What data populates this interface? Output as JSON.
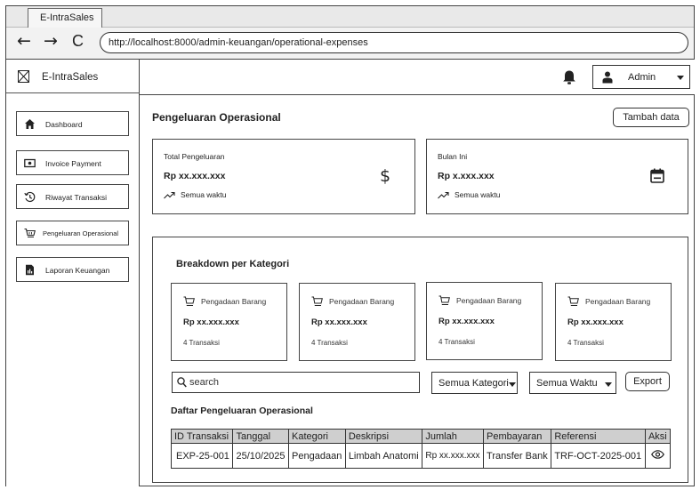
{
  "browser": {
    "tab_title": "E-IntraSales",
    "url": "http://localhost:8000/admin-keuangan/operational-expenses",
    "nav": {
      "back": "←",
      "forward": "→",
      "reload": "C"
    }
  },
  "sidebar": {
    "brand": "E-IntraSales",
    "items": [
      {
        "label": "Dashboard",
        "icon": "home-icon"
      },
      {
        "label": "Invoice Payment",
        "icon": "money-icon"
      },
      {
        "label": "Riwayat Transaksi",
        "icon": "history-icon"
      },
      {
        "label": "Pengeluaran Operasional",
        "icon": "cart-icon"
      },
      {
        "label": "Laporan Keuangan",
        "icon": "report-icon"
      }
    ]
  },
  "topbar": {
    "user": "Admin"
  },
  "page": {
    "title": "Pengeluaran Operasional",
    "add_button": "Tambah data"
  },
  "summary": [
    {
      "title": "Total Pengeluaran",
      "value": "Rp xx.xxx.xxx",
      "sub": "Semua waktu",
      "symbol": "$"
    },
    {
      "title": "Bulan Ini",
      "value": "Rp x.xxx.xxx",
      "sub": "Semua waktu",
      "icon": "calendar-icon"
    }
  ],
  "breakdown": {
    "title": "Breakdown per Kategori",
    "cards": [
      {
        "name": "Pengadaan Barang",
        "value": "Rp xx.xxx.xxx",
        "count": "4 Transaksi"
      },
      {
        "name": "Pengadaan Barang",
        "value": "Rp xx.xxx.xxx",
        "count": "4 Transaksi"
      },
      {
        "name": "Pengadaan Barang",
        "value": "Rp xx.xxx.xxx",
        "count": "4 Transaksi"
      },
      {
        "name": "Pengadaan Barang",
        "value": "Rp xx.xxx.xxx",
        "count": "4 Transaksi"
      }
    ]
  },
  "filters": {
    "search_placeholder": "search",
    "category": "Semua Kategori",
    "period": "Semua Waktu",
    "export": "Export"
  },
  "table": {
    "title": "Daftar Pengeluaran Operasional",
    "columns": [
      "ID Transaksi",
      "Tanggal",
      "Kategori",
      "Deskripsi",
      "Jumlah",
      "Pembayaran",
      "Referensi",
      "Aksi"
    ],
    "rows": [
      [
        "EXP-25-001",
        "25/10/2025",
        "Pengadaan",
        "Limbah Anatomi",
        "Rp xx.xxx.xxx",
        "Transfer Bank",
        "TRF-OCT-2025-001"
      ]
    ]
  }
}
